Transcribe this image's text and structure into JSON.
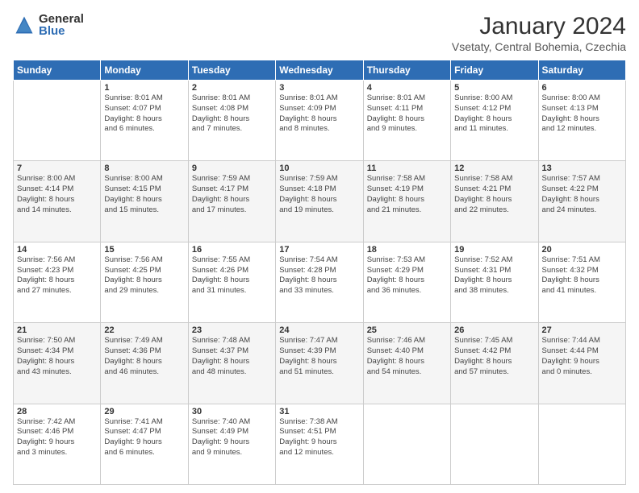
{
  "logo": {
    "general": "General",
    "blue": "Blue"
  },
  "title": "January 2024",
  "location": "Vsetaty, Central Bohemia, Czechia",
  "days_header": [
    "Sunday",
    "Monday",
    "Tuesday",
    "Wednesday",
    "Thursday",
    "Friday",
    "Saturday"
  ],
  "weeks": [
    [
      {
        "day": "",
        "info": ""
      },
      {
        "day": "1",
        "info": "Sunrise: 8:01 AM\nSunset: 4:07 PM\nDaylight: 8 hours\nand 6 minutes."
      },
      {
        "day": "2",
        "info": "Sunrise: 8:01 AM\nSunset: 4:08 PM\nDaylight: 8 hours\nand 7 minutes."
      },
      {
        "day": "3",
        "info": "Sunrise: 8:01 AM\nSunset: 4:09 PM\nDaylight: 8 hours\nand 8 minutes."
      },
      {
        "day": "4",
        "info": "Sunrise: 8:01 AM\nSunset: 4:11 PM\nDaylight: 8 hours\nand 9 minutes."
      },
      {
        "day": "5",
        "info": "Sunrise: 8:00 AM\nSunset: 4:12 PM\nDaylight: 8 hours\nand 11 minutes."
      },
      {
        "day": "6",
        "info": "Sunrise: 8:00 AM\nSunset: 4:13 PM\nDaylight: 8 hours\nand 12 minutes."
      }
    ],
    [
      {
        "day": "7",
        "info": "Sunrise: 8:00 AM\nSunset: 4:14 PM\nDaylight: 8 hours\nand 14 minutes."
      },
      {
        "day": "8",
        "info": "Sunrise: 8:00 AM\nSunset: 4:15 PM\nDaylight: 8 hours\nand 15 minutes."
      },
      {
        "day": "9",
        "info": "Sunrise: 7:59 AM\nSunset: 4:17 PM\nDaylight: 8 hours\nand 17 minutes."
      },
      {
        "day": "10",
        "info": "Sunrise: 7:59 AM\nSunset: 4:18 PM\nDaylight: 8 hours\nand 19 minutes."
      },
      {
        "day": "11",
        "info": "Sunrise: 7:58 AM\nSunset: 4:19 PM\nDaylight: 8 hours\nand 21 minutes."
      },
      {
        "day": "12",
        "info": "Sunrise: 7:58 AM\nSunset: 4:21 PM\nDaylight: 8 hours\nand 22 minutes."
      },
      {
        "day": "13",
        "info": "Sunrise: 7:57 AM\nSunset: 4:22 PM\nDaylight: 8 hours\nand 24 minutes."
      }
    ],
    [
      {
        "day": "14",
        "info": "Sunrise: 7:56 AM\nSunset: 4:23 PM\nDaylight: 8 hours\nand 27 minutes."
      },
      {
        "day": "15",
        "info": "Sunrise: 7:56 AM\nSunset: 4:25 PM\nDaylight: 8 hours\nand 29 minutes."
      },
      {
        "day": "16",
        "info": "Sunrise: 7:55 AM\nSunset: 4:26 PM\nDaylight: 8 hours\nand 31 minutes."
      },
      {
        "day": "17",
        "info": "Sunrise: 7:54 AM\nSunset: 4:28 PM\nDaylight: 8 hours\nand 33 minutes."
      },
      {
        "day": "18",
        "info": "Sunrise: 7:53 AM\nSunset: 4:29 PM\nDaylight: 8 hours\nand 36 minutes."
      },
      {
        "day": "19",
        "info": "Sunrise: 7:52 AM\nSunset: 4:31 PM\nDaylight: 8 hours\nand 38 minutes."
      },
      {
        "day": "20",
        "info": "Sunrise: 7:51 AM\nSunset: 4:32 PM\nDaylight: 8 hours\nand 41 minutes."
      }
    ],
    [
      {
        "day": "21",
        "info": "Sunrise: 7:50 AM\nSunset: 4:34 PM\nDaylight: 8 hours\nand 43 minutes."
      },
      {
        "day": "22",
        "info": "Sunrise: 7:49 AM\nSunset: 4:36 PM\nDaylight: 8 hours\nand 46 minutes."
      },
      {
        "day": "23",
        "info": "Sunrise: 7:48 AM\nSunset: 4:37 PM\nDaylight: 8 hours\nand 48 minutes."
      },
      {
        "day": "24",
        "info": "Sunrise: 7:47 AM\nSunset: 4:39 PM\nDaylight: 8 hours\nand 51 minutes."
      },
      {
        "day": "25",
        "info": "Sunrise: 7:46 AM\nSunset: 4:40 PM\nDaylight: 8 hours\nand 54 minutes."
      },
      {
        "day": "26",
        "info": "Sunrise: 7:45 AM\nSunset: 4:42 PM\nDaylight: 8 hours\nand 57 minutes."
      },
      {
        "day": "27",
        "info": "Sunrise: 7:44 AM\nSunset: 4:44 PM\nDaylight: 9 hours\nand 0 minutes."
      }
    ],
    [
      {
        "day": "28",
        "info": "Sunrise: 7:42 AM\nSunset: 4:46 PM\nDaylight: 9 hours\nand 3 minutes."
      },
      {
        "day": "29",
        "info": "Sunrise: 7:41 AM\nSunset: 4:47 PM\nDaylight: 9 hours\nand 6 minutes."
      },
      {
        "day": "30",
        "info": "Sunrise: 7:40 AM\nSunset: 4:49 PM\nDaylight: 9 hours\nand 9 minutes."
      },
      {
        "day": "31",
        "info": "Sunrise: 7:38 AM\nSunset: 4:51 PM\nDaylight: 9 hours\nand 12 minutes."
      },
      {
        "day": "",
        "info": ""
      },
      {
        "day": "",
        "info": ""
      },
      {
        "day": "",
        "info": ""
      }
    ]
  ]
}
